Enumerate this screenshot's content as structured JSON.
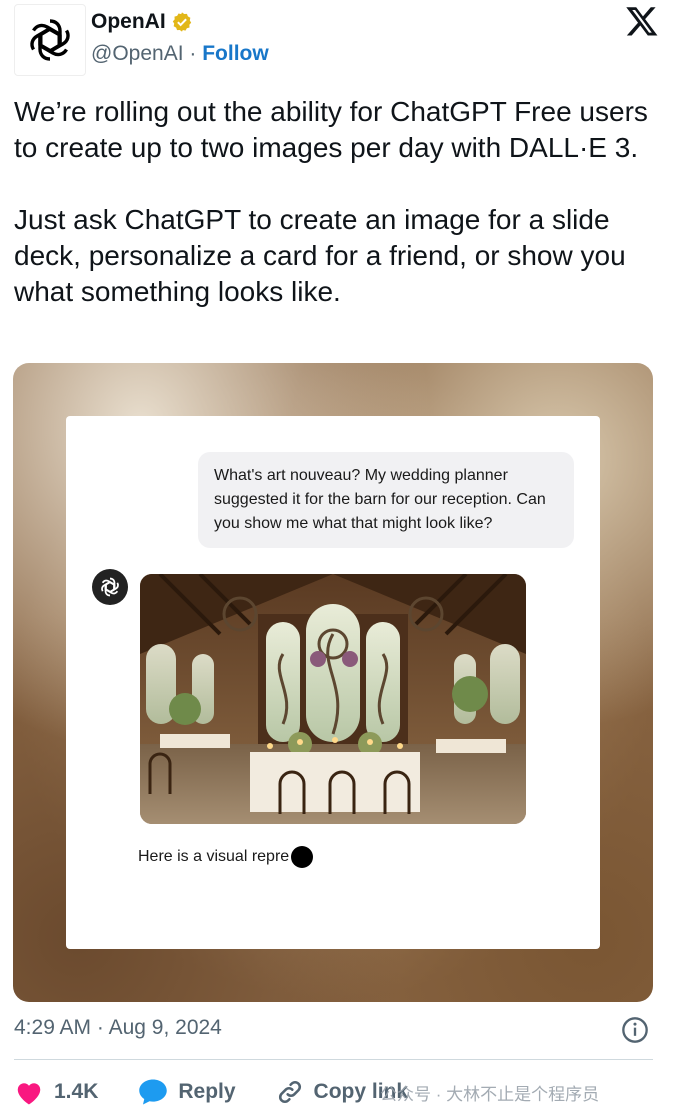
{
  "account": {
    "name": "OpenAI",
    "handle": "@OpenAI",
    "separator": "·",
    "follow_label": "Follow",
    "verified_color": "#e2b719"
  },
  "tweet": {
    "text": "We’re rolling out the ability for ChatGPT Free users to create up to two images per day with DALL·E 3.\n\nJust ask ChatGPT to create an image for a slide deck, personalize a card for a friend, or show you what something looks like."
  },
  "media": {
    "user_message": "What's art nouveau? My wedding planner suggested it for the barn for our reception. Can you show me what that might look like?",
    "assistant_reply": "Here is a visual repre",
    "image_subject": "art-nouveau-barn-wedding-reception"
  },
  "meta": {
    "time": "4:29 AM",
    "separator": "·",
    "date": "Aug 9, 2024"
  },
  "actions": {
    "like_count": "1.4K",
    "reply_label": "Reply",
    "copy_link_label": "Copy link",
    "like_color": "#f91880",
    "reply_color": "#1d9bf0"
  },
  "watermark": "公众号 · 大林不止是个程序员",
  "icons": {
    "x_logo": "x-logo-icon",
    "info": "info-icon",
    "like": "heart-icon",
    "reply": "speech-bubble-icon",
    "copy": "link-icon"
  }
}
